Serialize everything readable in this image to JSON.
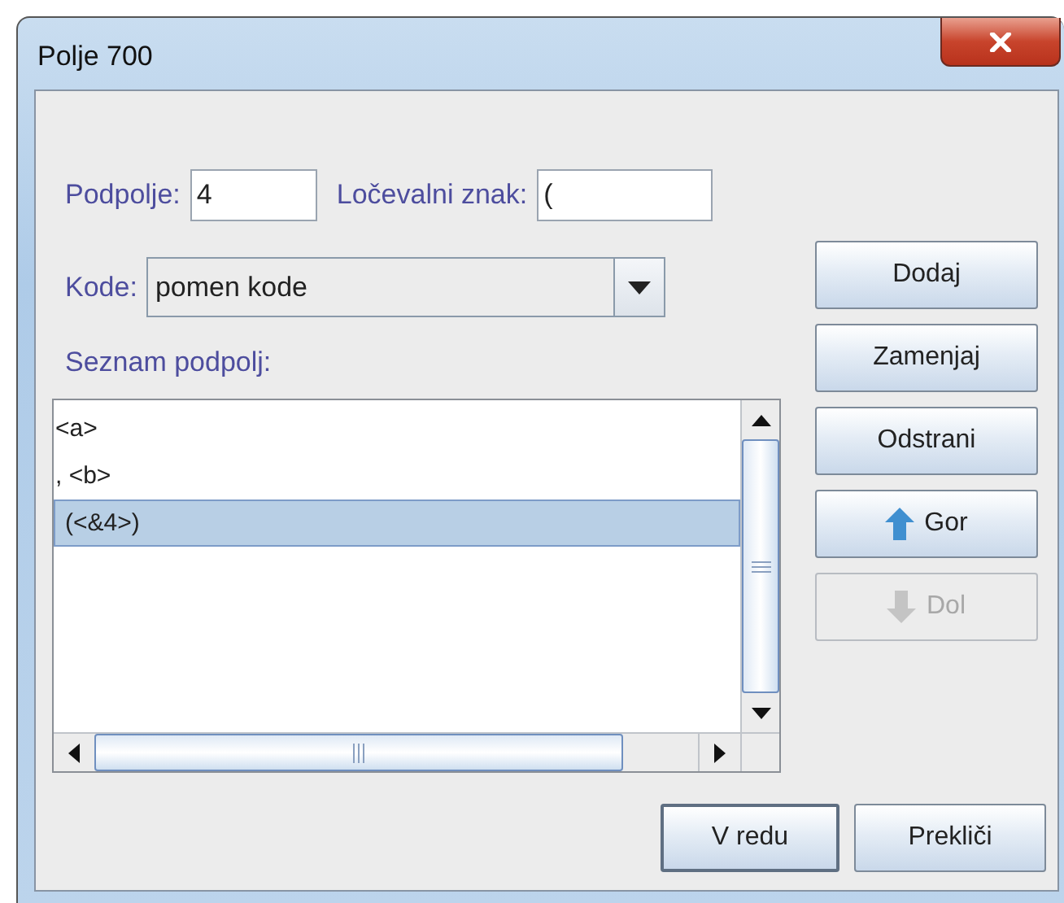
{
  "window": {
    "title": "Polje 700"
  },
  "fields": {
    "subfield_label": "Podpolje:",
    "subfield_value": "4",
    "separator_label": "Ločevalni znak:",
    "separator_value": "("
  },
  "codes": {
    "label": "Kode:",
    "value": "pomen kode"
  },
  "list": {
    "label": "Seznam podpolj:",
    "items": [
      {
        "text": "<a>",
        "selected": false
      },
      {
        "text": ", <b>",
        "selected": false
      },
      {
        "text": "(<&4>)",
        "selected": true
      }
    ]
  },
  "side_buttons": [
    {
      "label": "Dodaj",
      "kind": "plain",
      "disabled": false
    },
    {
      "label": "Zamenjaj",
      "kind": "plain",
      "disabled": false
    },
    {
      "label": "Odstrani",
      "kind": "plain",
      "disabled": false
    },
    {
      "label": "Gor",
      "kind": "up",
      "disabled": false
    },
    {
      "label": "Dol",
      "kind": "down",
      "disabled": true
    }
  ],
  "footer_buttons": [
    {
      "label": "V redu",
      "default": true
    },
    {
      "label": "Prekliči",
      "default": false
    }
  ]
}
